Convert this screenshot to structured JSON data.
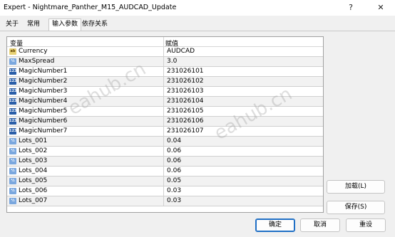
{
  "window": {
    "title": "Expert - Nightmare_Panther_M15_AUDCAD_Update",
    "help_glyph": "?",
    "close_glyph": "✕"
  },
  "tabs": [
    {
      "label": "关于"
    },
    {
      "label": "常用"
    },
    {
      "label": "输入参数",
      "active": true
    },
    {
      "label": "依存关系"
    }
  ],
  "table": {
    "col_variable": "变量",
    "col_value": "赋值",
    "rows": [
      {
        "name": "Currency",
        "value": "AUDCAD",
        "icon": "ab-string-icon"
      },
      {
        "name": "MaxSpread",
        "value": "3.0",
        "icon": "double-value-icon"
      },
      {
        "name": "MagicNumber1",
        "value": "231026101",
        "icon": "integer-value-icon"
      },
      {
        "name": "MagicNumber2",
        "value": "231026102",
        "icon": "integer-value-icon"
      },
      {
        "name": "MagicNumber3",
        "value": "231026103",
        "icon": "integer-value-icon"
      },
      {
        "name": "MagicNumber4",
        "value": "231026104",
        "icon": "integer-value-icon"
      },
      {
        "name": "MagicNumber5",
        "value": "231026105",
        "icon": "integer-value-icon"
      },
      {
        "name": "MagicNumber6",
        "value": "231026106",
        "icon": "integer-value-icon"
      },
      {
        "name": "MagicNumber7",
        "value": "231026107",
        "icon": "integer-value-icon"
      },
      {
        "name": "Lots_001",
        "value": "0.04",
        "icon": "double-value-icon"
      },
      {
        "name": "Lots_002",
        "value": "0.06",
        "icon": "double-value-icon"
      },
      {
        "name": "Lots_003",
        "value": "0.06",
        "icon": "double-value-icon"
      },
      {
        "name": "Lots_004",
        "value": "0.06",
        "icon": "double-value-icon"
      },
      {
        "name": "Lots_005",
        "value": "0.05",
        "icon": "double-value-icon"
      },
      {
        "name": "Lots_006",
        "value": "0.03",
        "icon": "double-value-icon"
      },
      {
        "name": "Lots_007",
        "value": "0.03",
        "icon": "double-value-icon"
      }
    ]
  },
  "buttons": {
    "load": "加载(L)",
    "save": "保存(S)",
    "ok": "确定",
    "cancel": "取消",
    "reset": "重设"
  },
  "watermark": "eahub.cn"
}
